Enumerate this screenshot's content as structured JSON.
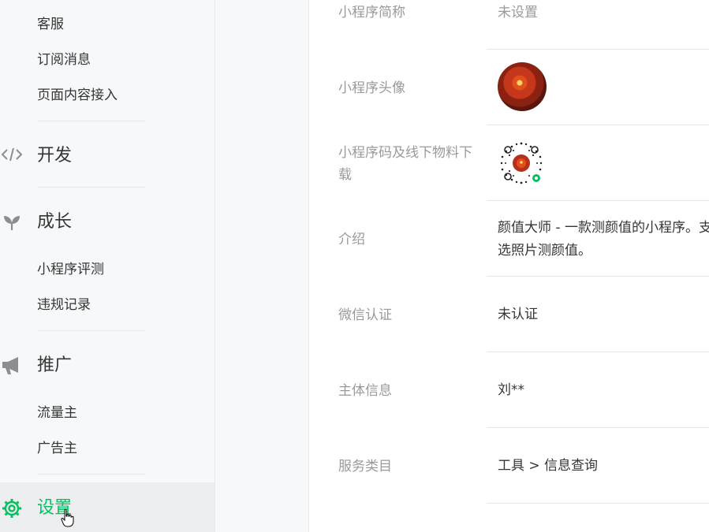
{
  "sidebar": {
    "items": [
      {
        "label": "客服"
      },
      {
        "label": "订阅消息"
      },
      {
        "label": "页面内容接入"
      }
    ],
    "sections": [
      {
        "title": "开发",
        "icon": "code-icon"
      },
      {
        "title": "成长",
        "icon": "sprout-icon",
        "items": [
          {
            "label": "小程序评测"
          },
          {
            "label": "违规记录"
          }
        ]
      },
      {
        "title": "推广",
        "icon": "megaphone-icon",
        "items": [
          {
            "label": "流量主"
          },
          {
            "label": "广告主"
          }
        ]
      },
      {
        "title": "设置",
        "icon": "gear-icon",
        "active": true
      }
    ],
    "accent_color": "#07c160"
  },
  "info": {
    "rows": [
      {
        "label": "小程序简称",
        "value": "未设置"
      },
      {
        "label": "小程序头像",
        "value": ""
      },
      {
        "label": "小程序码及线下物料下载",
        "value": ""
      },
      {
        "label": "介绍",
        "value_line1": "颜值大师 - 一款测颜值的小程序。支",
        "value_line2": "选照片测颜值。"
      },
      {
        "label": "微信认证",
        "value": "未认证"
      },
      {
        "label": "主体信息",
        "value": "刘**"
      },
      {
        "label": "服务类目",
        "value": "工具 > 信息查询"
      }
    ]
  }
}
